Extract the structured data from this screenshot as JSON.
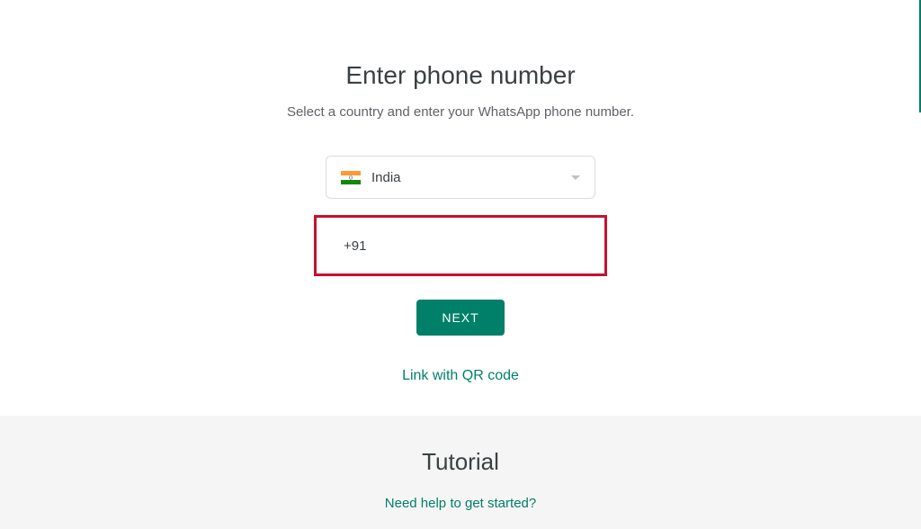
{
  "header": {
    "title": "Enter phone number",
    "subtitle": "Select a country and enter your WhatsApp phone number."
  },
  "country_selector": {
    "selected_country": "India",
    "country_code": "+91"
  },
  "next_button_label": "NEXT",
  "qr_link_label": "Link with QR code",
  "tutorial": {
    "title": "Tutorial",
    "help_text": "Need help to get started?"
  }
}
